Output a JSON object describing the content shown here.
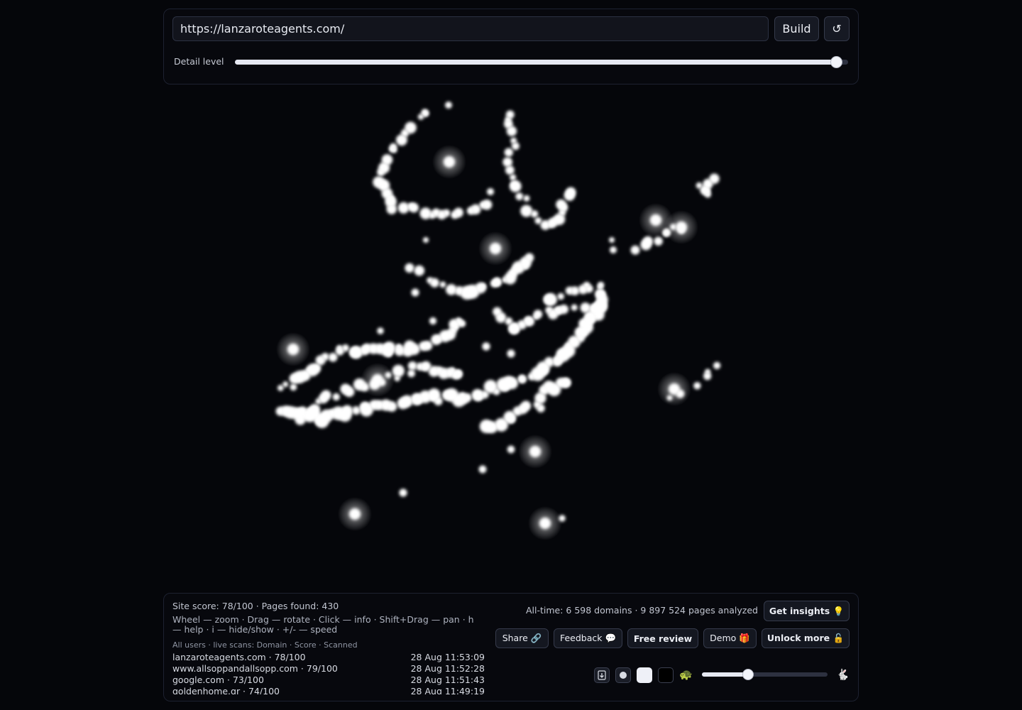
{
  "toolbar": {
    "url_value": "https://lanzaroteagents.com/",
    "build_label": "Build",
    "reload_icon": "↺",
    "detail_label": "Detail level",
    "detail_level": 0.98
  },
  "stats": {
    "site_score": "Site score: 78/100 · Pages found: 430",
    "help": "Wheel — zoom · Drag — rotate · Click — info · Shift+Drag — pan · h — help · i — hide/show · +/- — speed",
    "alltime": "All-time: 6 598 domains · 9 897 524 pages analyzed"
  },
  "scans": {
    "header": "All users · live scans: Domain · Score · Scanned",
    "rows": [
      {
        "domain": "lanzaroteagents.com · 78/100",
        "time": "28 Aug 11:53:09"
      },
      {
        "domain": "www.allsoppandallsopp.com · 79/100",
        "time": "28 Aug 11:52:28"
      },
      {
        "domain": "google.com · 73/100",
        "time": "28 Aug 11:51:43"
      },
      {
        "domain": "goldenhome.gr · 74/100",
        "time": "28 Aug 11:49:19"
      }
    ]
  },
  "actions": {
    "insights": "Get insights 💡",
    "share": "Share 🔗",
    "feedback": "Feedback 💬",
    "free_review": "Free review",
    "demo": "Demo 🎁",
    "unlock": "Unlock more 🔓"
  },
  "controls": {
    "slow_icon": "🐢",
    "fast_icon": "🐇",
    "speed_level": 0.37
  },
  "icons": [
    "reload-icon",
    "download-icon",
    "dot-icon",
    "turtle-icon",
    "rabbit-icon"
  ],
  "colors": {
    "background": "#05060a",
    "node": "#ffffff",
    "panel": "#07080d",
    "border": "#1d2130"
  }
}
